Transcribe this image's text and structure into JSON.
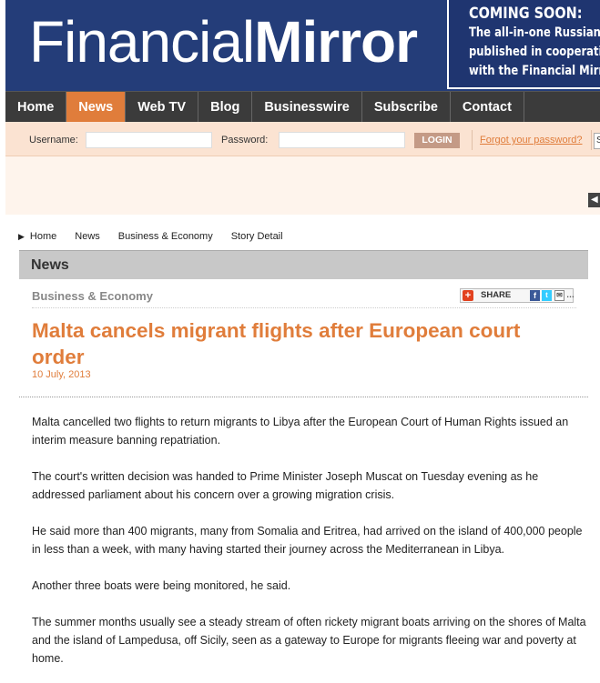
{
  "header": {
    "logo_part1": "Financial",
    "logo_part2": "Mirror",
    "promo": {
      "title": "COMING SOON:",
      "line1": "The all-in-one Russian",
      "line2": "published in cooperatio",
      "line3": "with the Financial Mirr"
    }
  },
  "nav": {
    "items": [
      "Home",
      "News",
      "Web TV",
      "Blog",
      "Businesswire",
      "Subscribe",
      "Contact"
    ],
    "active": "News"
  },
  "login": {
    "username_label": "Username:",
    "username_value": "",
    "password_label": "Password:",
    "password_value": "",
    "login_button": "LOGIN",
    "forgot_link": "Forgot your password?",
    "search_stub": "S"
  },
  "breadcrumb": [
    "Home",
    "News",
    "Business & Economy",
    "Story Detail"
  ],
  "section": {
    "title": "News"
  },
  "article": {
    "category": "Business & Economy",
    "share_label": "SHARE",
    "headline": "Malta cancels migrant flights after European court order",
    "date": "10 July, 2013",
    "paragraphs": [
      "Malta cancelled two flights to return migrants to Libya after the European Court of Human Rights issued an interim measure banning repatriation.",
      "The court's written decision was handed to Prime Minister Joseph Muscat on Tuesday evening as he addressed parliament about his concern over a growing migration crisis.",
      "He said more than 400 migrants, many from Somalia and Eritrea, had arrived on the island of 400,000 people in less than a week, with many having started their journey across the Mediterranean in Libya.",
      "Another three boats were being monitored, he said.",
      "The summer months usually see a steady stream of often rickety migrant boats arriving on the shores of Malta and the island of Lampedusa, off Sicily, seen as a gateway to Europe for migrants fleeing war and poverty at home."
    ]
  },
  "colors": {
    "brand_blue": "#243d79",
    "accent_orange": "#e07d3b",
    "nav_dark": "#3b3b3b"
  }
}
